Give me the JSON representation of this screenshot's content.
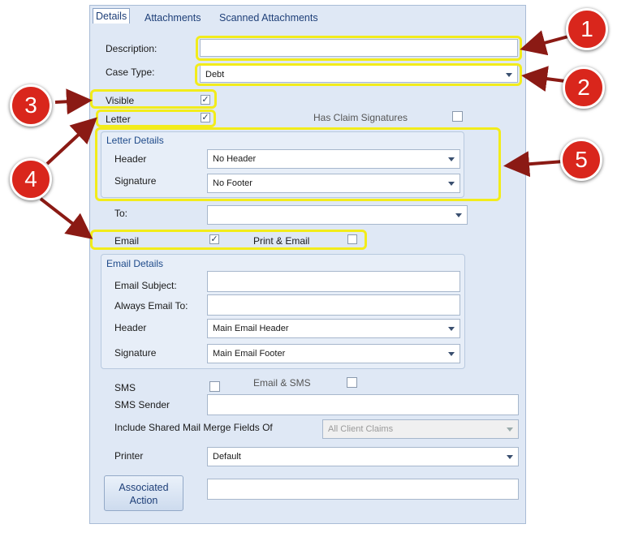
{
  "tabs": [
    {
      "label": "Details",
      "active": true
    },
    {
      "label": "Attachments",
      "active": false
    },
    {
      "label": "Scanned Attachments",
      "active": false
    }
  ],
  "form": {
    "description": {
      "label": "Description:",
      "value": ""
    },
    "case_type": {
      "label": "Case Type:",
      "value": "Debt"
    },
    "visible": {
      "label": "Visible",
      "checked": true
    },
    "letter": {
      "label": "Letter",
      "checked": true
    },
    "has_claim_signatures": {
      "label": "Has Claim Signatures",
      "checked": false
    },
    "letter_details": {
      "title": "Letter Details",
      "header": {
        "label": "Header",
        "value": "No Header"
      },
      "signature": {
        "label": "Signature",
        "value": "No Footer"
      }
    },
    "to": {
      "label": "To:",
      "value": ""
    },
    "email": {
      "label": "Email",
      "checked": true
    },
    "print_email": {
      "label": "Print & Email",
      "checked": false
    },
    "email_details": {
      "title": "Email Details",
      "subject": {
        "label": "Email Subject:",
        "value": ""
      },
      "always_email_to": {
        "label": "Always Email To:",
        "value": ""
      },
      "header": {
        "label": "Header",
        "value": "Main Email Header"
      },
      "signature": {
        "label": "Signature",
        "value": "Main Email Footer"
      }
    },
    "sms": {
      "label": "SMS",
      "checked": false
    },
    "email_sms": {
      "label": "Email & SMS",
      "checked": false
    },
    "sms_sender": {
      "label": "SMS Sender",
      "value": ""
    },
    "shared_merge": {
      "label": "Include Shared Mail Merge Fields Of",
      "value": "All Client Claims"
    },
    "printer": {
      "label": "Printer",
      "value": "Default"
    },
    "associated_action": {
      "label_line1": "Associated",
      "label_line2": "Action",
      "value": ""
    }
  },
  "check_glyph": "✓",
  "callouts": [
    "1",
    "2",
    "3",
    "4",
    "5"
  ],
  "colors": {
    "highlight": "#f2ec1b",
    "callout": "#d9261c",
    "arrow": "#8b1a14"
  }
}
